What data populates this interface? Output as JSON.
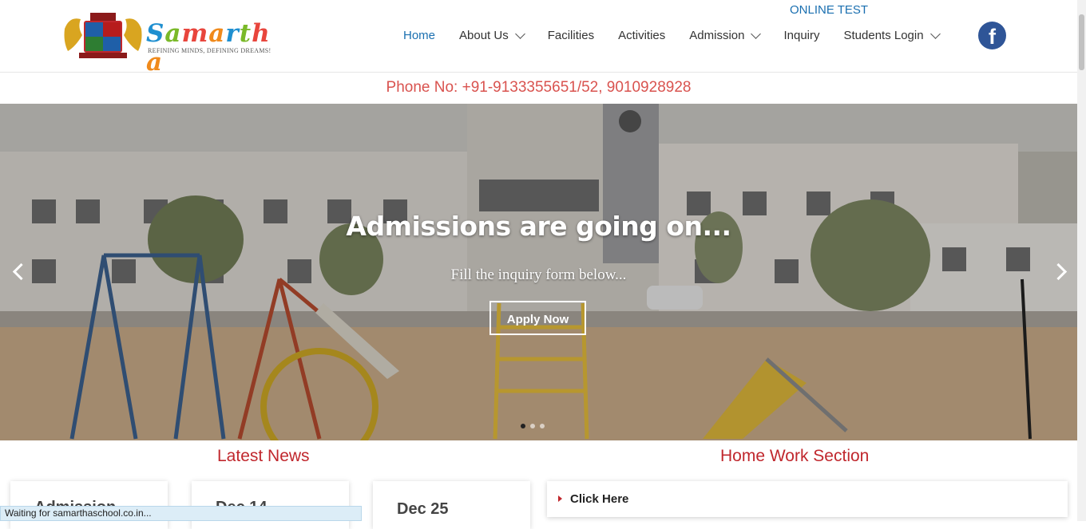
{
  "brand": {
    "name": "Samartha",
    "tagline": "REFINING MINDS, DEFINING DREAMS!",
    "letter_colors": [
      "#1f8fd0",
      "#7ab929",
      "#e8453c",
      "#f08a1c",
      "#1f8fd0",
      "#7ab929",
      "#e8453c",
      "#f08a1c"
    ]
  },
  "header": {
    "online_test": "ONLINE TEST",
    "nav": [
      {
        "label": "Home",
        "active": true,
        "dropdown": false
      },
      {
        "label": "About Us",
        "active": false,
        "dropdown": true
      },
      {
        "label": "Facilities",
        "active": false,
        "dropdown": false
      },
      {
        "label": "Activities",
        "active": false,
        "dropdown": false
      },
      {
        "label": "Admission",
        "active": false,
        "dropdown": true
      },
      {
        "label": "Inquiry",
        "active": false,
        "dropdown": false
      },
      {
        "label": "Students Login",
        "active": false,
        "dropdown": true
      }
    ],
    "social_icon": "facebook-icon",
    "social_glyph": "f"
  },
  "contact": {
    "phone": "Phone No: +91-9133355651/52, 9010928928"
  },
  "hero": {
    "title": "Admissions are going on...",
    "subtitle": "Fill the inquiry form below...",
    "button": "Apply Now",
    "slide_count": 3,
    "active_slide": 1
  },
  "news": {
    "title": "Latest News",
    "cards": [
      "Admission",
      "Dec 14",
      "Dec 25"
    ]
  },
  "homework": {
    "title": "Home Work Section",
    "link": "Click Here"
  },
  "status_bar": "Waiting for samarthaschool.co.in...",
  "colors": {
    "accent_blue": "#1a6fb0",
    "accent_red": "#c0272d",
    "phone_red": "#d9534f",
    "facebook": "#2f5597"
  }
}
